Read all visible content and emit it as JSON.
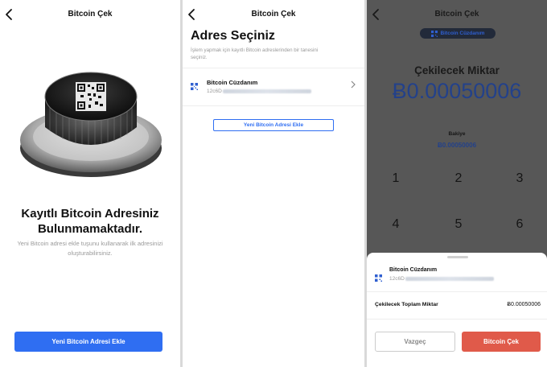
{
  "colors": {
    "accent": "#2f6ef2",
    "danger": "#e05a4a",
    "amount": "#23418a"
  },
  "screen1": {
    "title": "Bitcoin Çek",
    "empty_title": "Kayıtlı Bitcoin Adresiniz Bulunmamaktadır.",
    "empty_subtitle": "Yeni Bitcoin adresi ekle tuşunu kullanarak ilk adresinizi oluşturabilirsiniz.",
    "add_button": "Yeni Bitcoin Adresi Ekle"
  },
  "screen2": {
    "title": "Bitcoin Çek",
    "heading": "Adres Seçiniz",
    "description": "İşlem yapmak için kayıtlı Bitcoin adreslerinden bir tanesini seçiniz.",
    "wallet_name": "Bitcoin Cüzdanım",
    "wallet_address_prefix": "12c6D",
    "add_button": "Yeni Bitcoin Adresi Ekle"
  },
  "screen3": {
    "title": "Bitcoin Çek",
    "wallet_chip": "Bitcoin Cüzdanım",
    "amount_label": "Çekilecek Miktar",
    "amount_value": "Ƀ0.00050006",
    "balance_label": "Bakiye",
    "balance_value": "Ƀ0.00050006",
    "keypad": [
      "1",
      "2",
      "3",
      "4",
      "5",
      "6"
    ],
    "sheet": {
      "wallet_name": "Bitcoin Cüzdanım",
      "wallet_address_prefix": "12c6D",
      "total_label": "Çekilecek Toplam Miktar",
      "total_value": "Ƀ0.00050006",
      "cancel_button": "Vazgeç",
      "confirm_button": "Bitcoin Çek"
    }
  }
}
